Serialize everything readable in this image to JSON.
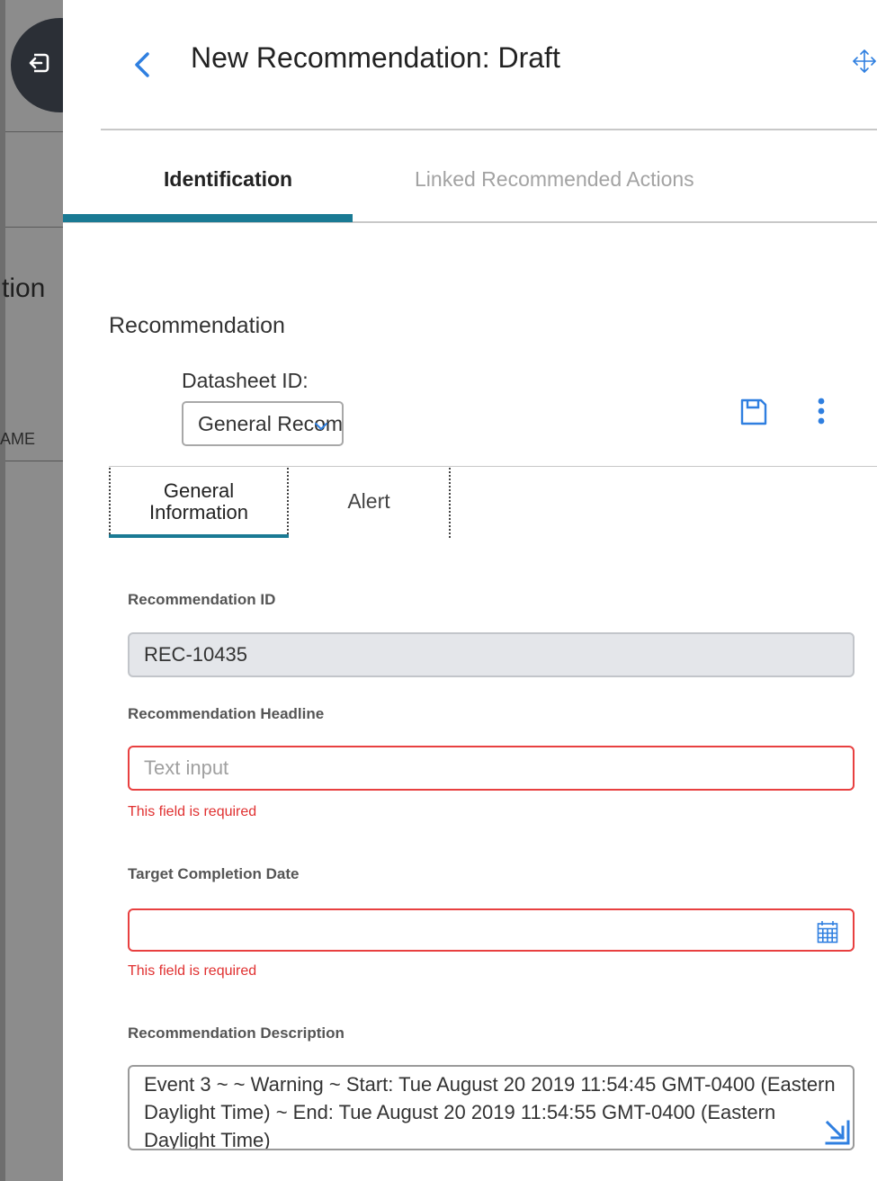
{
  "backdrop": {
    "fragment_heading": "tion",
    "fragment_column": "AME"
  },
  "header": {
    "title": "New Recommendation: Draft"
  },
  "tabs": [
    {
      "label": "Identification",
      "active": true
    },
    {
      "label": "Linked Recommended Actions",
      "active": false
    }
  ],
  "section": {
    "title": "Recommendation",
    "datasheet_label": "Datasheet ID:",
    "datasheet_value": "General Recom"
  },
  "sub_tabs": [
    {
      "label": "General Information",
      "active": true
    },
    {
      "label": "Alert",
      "active": false
    }
  ],
  "form": {
    "recommendation_id": {
      "label": "Recommendation ID",
      "value": "REC-10435"
    },
    "headline": {
      "label": "Recommendation Headline",
      "placeholder": "Text input",
      "error": "This field is required"
    },
    "target_date": {
      "label": "Target Completion Date",
      "value": "",
      "error": "This field is required"
    },
    "description": {
      "label": "Recommendation Description",
      "value": "Event 3 ~ ~ Warning  ~ Start: Tue August 20 2019 11:54:45 GMT-0400 (Eastern Daylight Time) ~ End: Tue August 20 2019 11:54:55 GMT-0400 (Eastern Daylight Time)"
    }
  },
  "colors": {
    "accent": "#1a7a94",
    "error": "#e84040",
    "icon_blue": "#2f7fe0"
  },
  "icons": [
    "logout-icon",
    "back-chevron-icon",
    "move-icon",
    "save-icon",
    "more-vertical-icon",
    "dropdown-chevron-icon",
    "calendar-icon",
    "expand-icon"
  ]
}
